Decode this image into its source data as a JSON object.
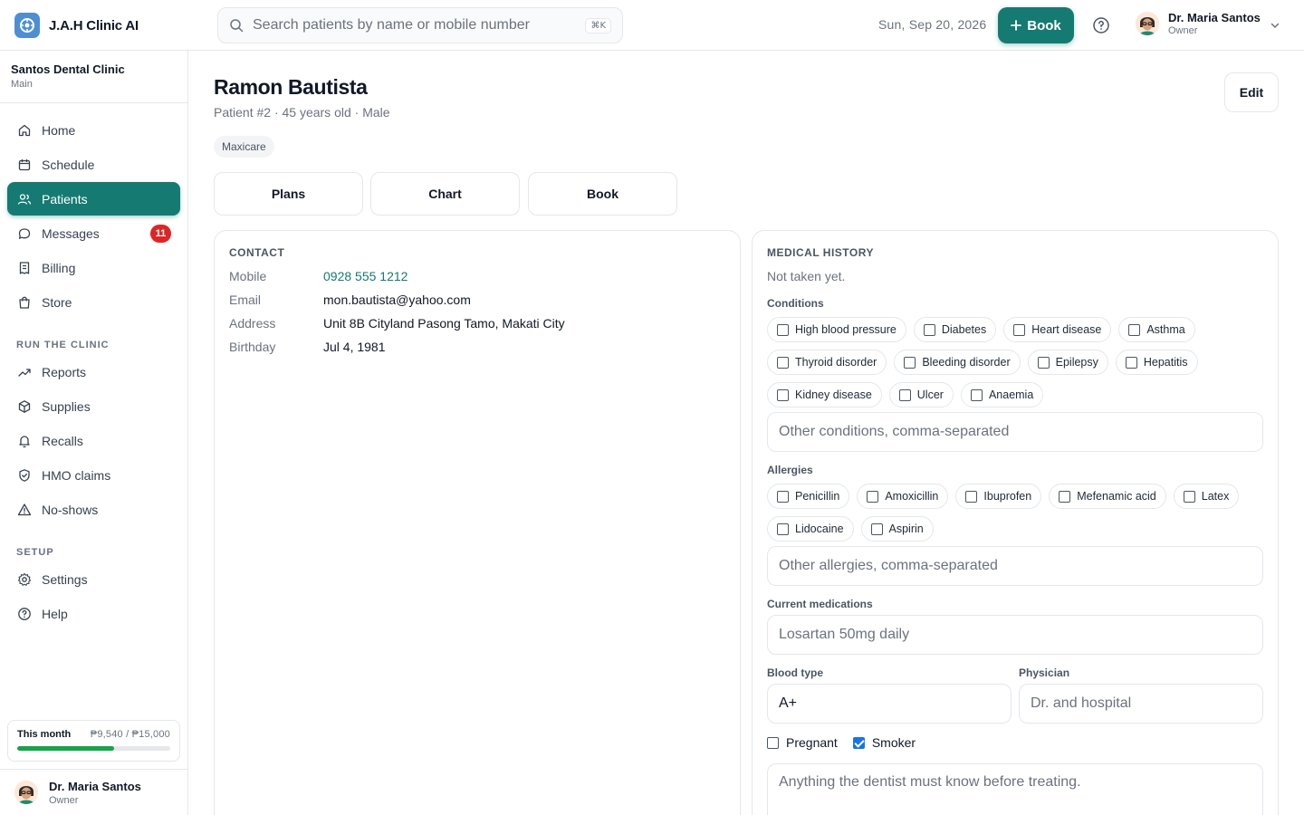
{
  "app": {
    "name": "J.A.H Clinic AI"
  },
  "search": {
    "placeholder": "Search patients by name or mobile number",
    "shortcut": "⌘K"
  },
  "header": {
    "date": "Sun, Sep 20, 2026",
    "book_label": "Book",
    "user_name": "Dr. Maria Santos",
    "user_role": "Owner"
  },
  "clinic": {
    "name": "Santos Dental Clinic",
    "branch": "Main"
  },
  "nav": {
    "main": [
      {
        "label": "Home",
        "icon": "home-icon"
      },
      {
        "label": "Schedule",
        "icon": "calendar-icon"
      },
      {
        "label": "Patients",
        "icon": "users-icon",
        "active": true
      },
      {
        "label": "Messages",
        "icon": "chat-icon",
        "badge": "11"
      },
      {
        "label": "Billing",
        "icon": "receipt-icon"
      },
      {
        "label": "Store",
        "icon": "shopping-bag-icon"
      }
    ],
    "run_label": "RUN THE CLINIC",
    "run": [
      {
        "label": "Reports",
        "icon": "trending-up-icon"
      },
      {
        "label": "Supplies",
        "icon": "box-icon"
      },
      {
        "label": "Recalls",
        "icon": "bell-icon"
      },
      {
        "label": "HMO claims",
        "icon": "shield-check-icon"
      },
      {
        "label": "No-shows",
        "icon": "warning-icon"
      }
    ],
    "setup_label": "SETUP",
    "setup": [
      {
        "label": "Settings",
        "icon": "gear-icon"
      },
      {
        "label": "Help",
        "icon": "help-icon"
      }
    ]
  },
  "month": {
    "label": "This month",
    "value": "₱9,540 / ₱15,000",
    "progress": 0.636
  },
  "sidebar_user": {
    "name": "Dr. Maria Santos",
    "role": "Owner"
  },
  "patient": {
    "name": "Ramon Bautista",
    "meta": "Patient #2 · 45 years old · Male",
    "tag": "Maxicare",
    "edit_label": "Edit",
    "actions": [
      "Plans",
      "Chart",
      "Book"
    ]
  },
  "contact": {
    "title": "CONTACT",
    "rows": [
      {
        "label": "Mobile",
        "value": "0928 555 1212"
      },
      {
        "label": "Email",
        "value": "mon.bautista@yahoo.com"
      },
      {
        "label": "Address",
        "value": "Unit 8B Cityland Pasong Tamo, Makati City"
      },
      {
        "label": "Birthday",
        "value": "Jul 4, 1981"
      }
    ]
  },
  "medical": {
    "title": "MEDICAL HISTORY",
    "note": "Not taken yet.",
    "conditions_label": "Conditions",
    "conditions": [
      "High blood pressure",
      "Diabetes",
      "Heart disease",
      "Asthma",
      "Thyroid disorder",
      "Bleeding disorder",
      "Epilepsy",
      "Hepatitis",
      "Kidney disease",
      "Ulcer",
      "Anaemia"
    ],
    "other_conditions_placeholder": "Other conditions, comma-separated",
    "allergies_label": "Allergies",
    "allergies": [
      "Penicillin",
      "Amoxicillin",
      "Ibuprofen",
      "Mefenamic acid",
      "Latex",
      "Lidocaine",
      "Aspirin"
    ],
    "other_allergies_placeholder": "Other allergies, comma-separated",
    "medications_label": "Current medications",
    "medications_placeholder": "Losartan 50mg daily",
    "blood_type_label": "Blood type",
    "blood_type_value": "A+",
    "physician_label": "Physician",
    "physician_placeholder": "Dr. and hospital",
    "pregnant_label": "Pregnant",
    "pregnant_checked": false,
    "smoker_label": "Smoker",
    "smoker_checked": true,
    "notes_placeholder": "Anything the dentist must know before treating."
  }
}
